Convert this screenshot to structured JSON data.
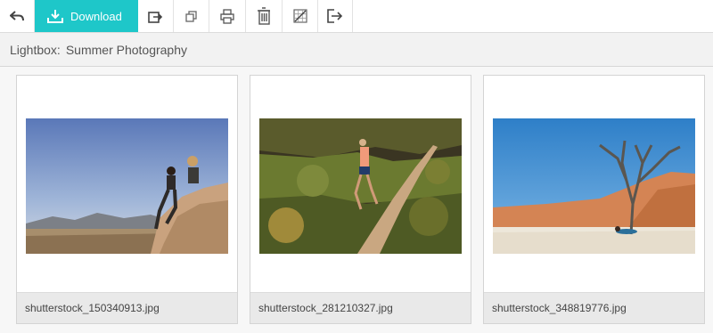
{
  "toolbar": {
    "back_icon": "back-arrow-icon",
    "download_label": "Download",
    "download_icon": "download-icon",
    "tools": [
      {
        "icon": "share-icon"
      },
      {
        "icon": "duplicate-icon"
      },
      {
        "icon": "print-icon"
      },
      {
        "icon": "trash-icon"
      },
      {
        "icon": "deselect-grid-icon"
      },
      {
        "icon": "exit-icon"
      }
    ],
    "accent_color": "#1ec7c9"
  },
  "lightbox": {
    "label": "Lightbox:",
    "name": "Summer Photography"
  },
  "images": [
    {
      "filename": "shutterstock_150340913.jpg"
    },
    {
      "filename": "shutterstock_281210327.jpg"
    },
    {
      "filename": "shutterstock_348819776.jpg"
    }
  ]
}
